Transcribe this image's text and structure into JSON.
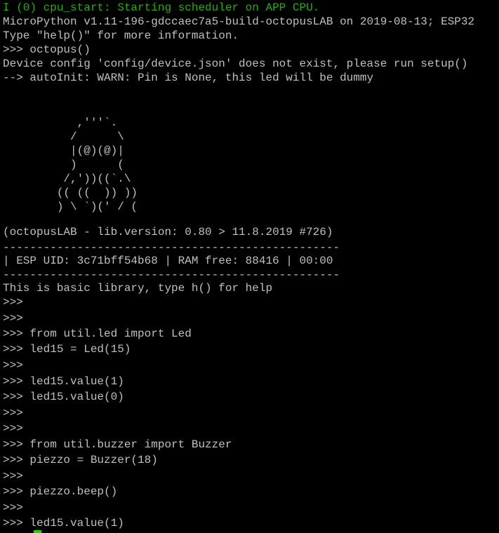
{
  "terminal": {
    "colors": {
      "background": "#000000",
      "text": "#c0c0c0",
      "log_info": "#1fb300",
      "cursor": "#1fd400"
    },
    "lines": [
      "I (0) cpu_start: Starting scheduler on APP CPU.",
      "MicroPython v1.11-196-gdccaec7a5-build-octopusLAB on 2019-08-13; ESP32",
      "Type \"help()\" for more information.",
      ">>> octopus()",
      "Device config 'config/device.json' does not exist, please run setup()",
      "--> autoInit: WARN: Pin is None, this led will be dummy",
      "",
      "",
      "           ,'''`.",
      "          /      \\",
      "          |(@)(@)|",
      "          )      (",
      "         /,'))((`.\\",
      "        (( ((  )) ))",
      "        ) \\ `)(' / (",
      "",
      "(octopusLAB - lib.version: 0.80 > 11.8.2019 #726)",
      "--------------------------------------------------",
      "| ESP UID: 3c71bff54b68 | RAM free: 88416 | 00:00",
      "--------------------------------------------------",
      "This is basic library, type h() for help",
      ">>>",
      ">>>",
      ">>> from util.led import Led",
      ">>> led15 = Led(15)",
      ">>>",
      ">>> led15.value(1)",
      ">>> led15.value(0)",
      ">>>",
      ">>>",
      ">>> from util.buzzer import Buzzer",
      ">>> piezzo = Buzzer(18)",
      ">>>",
      ">>> piezzo.beep()",
      ">>>",
      ">>> led15.value(1)"
    ]
  }
}
